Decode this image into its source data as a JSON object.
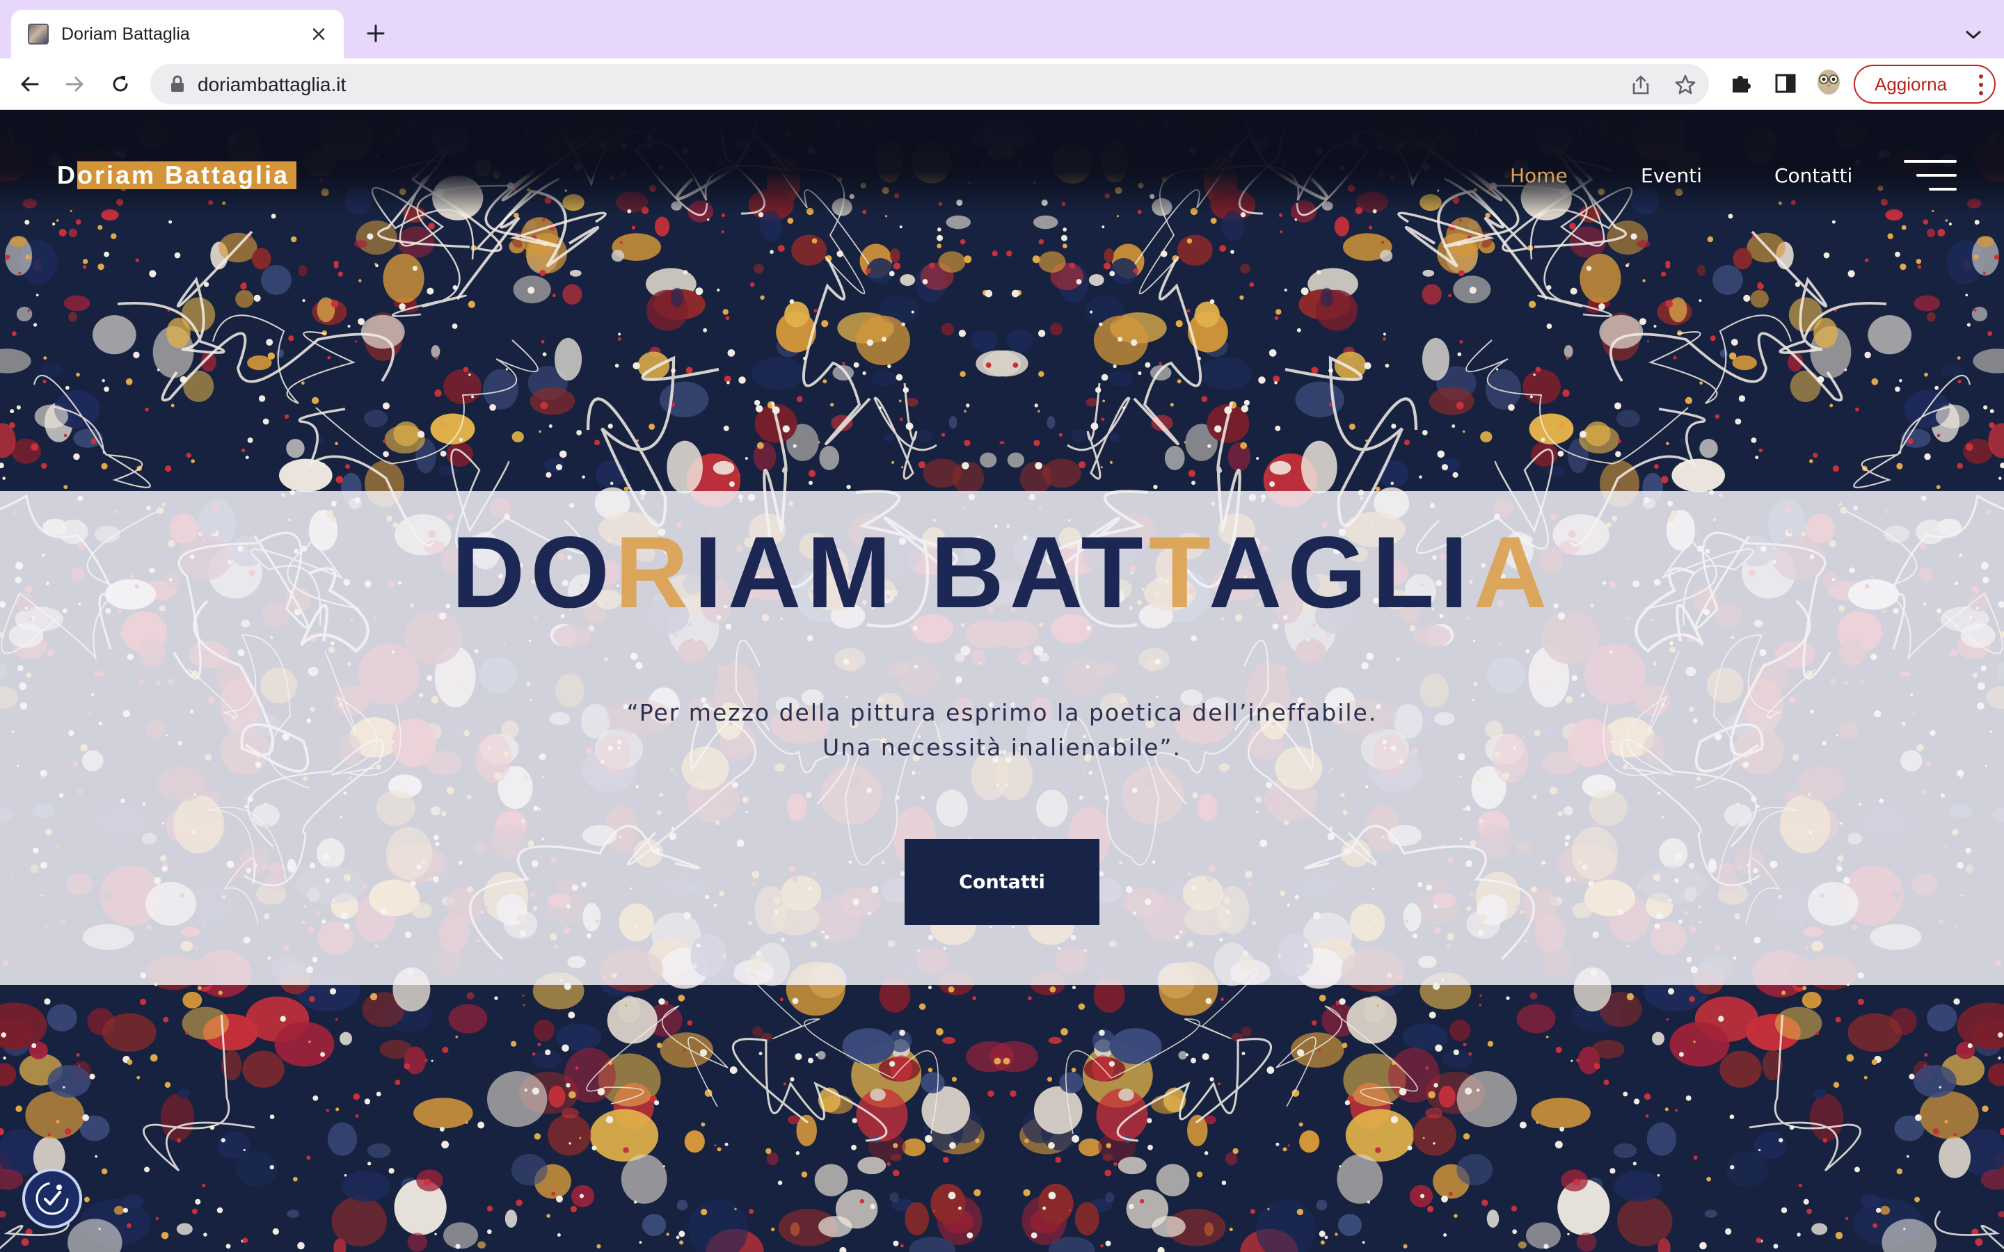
{
  "browser": {
    "tab_title": "Doriam Battaglia",
    "url": "doriambattaglia.it",
    "update_label": "Aggiorna",
    "colors": {
      "tabbar": "#e6d7fb",
      "update": "#c5221f"
    }
  },
  "site": {
    "logo_first": "D",
    "logo_rest": "oriam Battaglia",
    "nav": {
      "home": "Home",
      "events": "Eventi",
      "contacts": "Contatti"
    },
    "hero": {
      "title_parts": [
        "DO",
        "R",
        "IAM BAT",
        "T",
        "AGLI",
        "A"
      ],
      "quote": "“Per mezzo della pittura esprimo la poetica dell’ineffabile. Una necessità inalienabile”.",
      "cta_label": "Contatti"
    },
    "colors": {
      "accent": "#d4953a",
      "navy": "#172448",
      "title": "#1c2754"
    }
  }
}
